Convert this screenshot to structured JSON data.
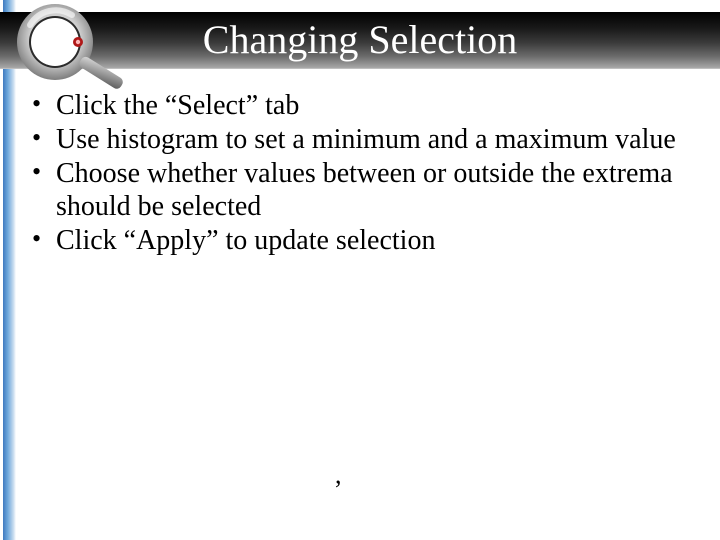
{
  "title": "Changing Selection",
  "bullets": [
    "Click the “Select” tab",
    "Use histogram to set a minimum and a maximum value",
    "Choose whether values between or outside the extrema should be selected",
    "Click “Apply” to update selection"
  ],
  "stray": ","
}
